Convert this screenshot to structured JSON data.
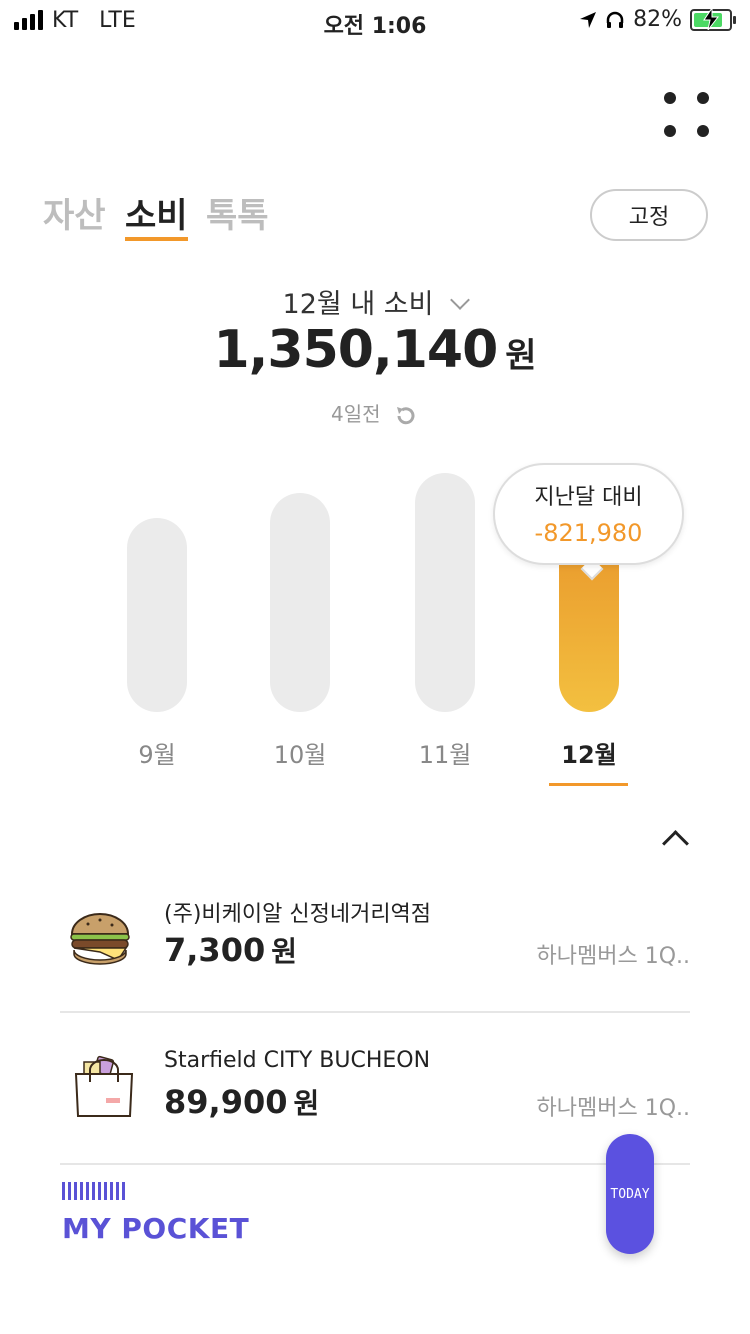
{
  "status_bar": {
    "carrier": "KT",
    "network": "LTE",
    "time": "오전 1:06",
    "battery": "82%",
    "icons": [
      "signal-icon",
      "location-arrow-icon",
      "headphones-icon",
      "battery-charging-icon"
    ]
  },
  "tabs": [
    {
      "label": "자산",
      "active": false
    },
    {
      "label": "소비",
      "active": true
    },
    {
      "label": "톡톡",
      "active": false
    }
  ],
  "fix_button": "고정",
  "summary": {
    "period": "12월 내 소비",
    "amount": "1,350,140",
    "unit": "원",
    "updated": "4일전"
  },
  "chart_data": {
    "type": "bar",
    "categories": [
      "9월",
      "10월",
      "11월",
      "12월"
    ],
    "active_index": 3,
    "tooltip": {
      "title": "지난달 대비",
      "value": "-821,980"
    },
    "colors": {
      "inactive": "#ebebeb",
      "active": "#f0a63a"
    }
  },
  "transactions": [
    {
      "name": "(주)비케이알 신정네거리역점",
      "amount": "7,300",
      "unit": "원",
      "card": "하나멤버스 1Q..",
      "icon": "burger-icon"
    },
    {
      "name": "Starfield CITY BUCHEON",
      "amount": "89,900",
      "unit": "원",
      "card": "하나멤버스 1Q..",
      "icon": "shopping-bag-icon"
    }
  ],
  "pocket": {
    "label": "MY POCKET"
  },
  "today_button": "TODAY",
  "colors": {
    "accent": "#f2982a",
    "pocket": "#5a52d6",
    "today": "#5b51e0"
  }
}
